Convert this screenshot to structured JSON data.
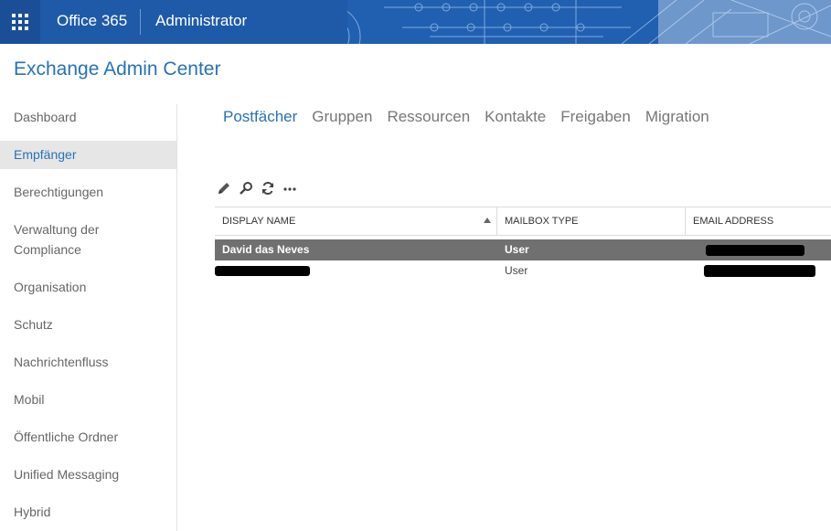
{
  "topbar": {
    "waffle_icon": "app-launcher-icon",
    "brand": "Office 365",
    "app_title": "Administrator",
    "colors": {
      "bar": "#1f5aa8",
      "waffle_bg": "#1a4f97"
    }
  },
  "page": {
    "title": "Exchange Admin Center",
    "accent": "#2672b8"
  },
  "sidebar": {
    "items": [
      {
        "label": "Dashboard"
      },
      {
        "label": "Empfänger"
      },
      {
        "label": "Berechtigungen"
      },
      {
        "label": "Verwaltung der Compliance"
      },
      {
        "label": "Organisation"
      },
      {
        "label": "Schutz"
      },
      {
        "label": "Nachrichtenfluss"
      },
      {
        "label": "Mobil"
      },
      {
        "label": "Öffentliche Ordner"
      },
      {
        "label": "Unified Messaging"
      },
      {
        "label": "Hybrid"
      }
    ],
    "active_index": 1
  },
  "tabs": [
    {
      "label": "Postfächer"
    },
    {
      "label": "Gruppen"
    },
    {
      "label": "Ressourcen"
    },
    {
      "label": "Kontakte"
    },
    {
      "label": "Freigaben"
    },
    {
      "label": "Migration"
    }
  ],
  "toolbar": {
    "icons": [
      "edit-pencil-icon",
      "search-icon",
      "refresh-icon",
      "more-ellipsis-icon"
    ]
  },
  "table": {
    "columns": [
      "DISPLAY NAME",
      "MAILBOX TYPE",
      "EMAIL ADDRESS"
    ],
    "sort": {
      "column": "DISPLAY NAME",
      "direction": "ascending"
    },
    "rows": [
      {
        "display_name": "David das Neves",
        "mailbox_type": "User",
        "email_redacted": true,
        "selected": true
      },
      {
        "display_name_redacted": true,
        "mailbox_type": "User",
        "email_redacted": true,
        "selected": false
      }
    ]
  }
}
